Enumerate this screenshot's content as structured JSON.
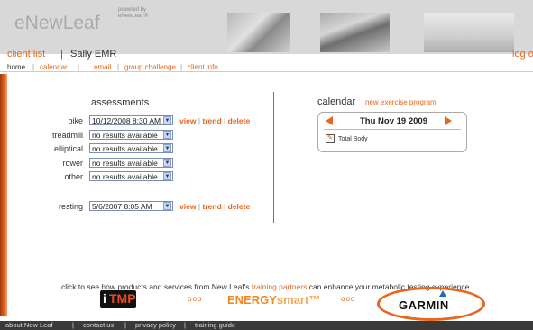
{
  "header": {
    "logo": "eNewLeaf",
    "powered_by": "powered by",
    "powered_by_brand": "eNewLeaf ®",
    "images": [
      "cyclists-photo",
      "spin-class-photo",
      "runner-photo"
    ],
    "client_list_label": "client list",
    "client_separator": "|",
    "client_name": "Sally EMR",
    "logout_label": "log out"
  },
  "nav": {
    "items": [
      "home",
      "calendar",
      "email",
      "group challenge",
      "client info"
    ],
    "separator": "|"
  },
  "assessments": {
    "title": "assessments",
    "rows": [
      {
        "label": "bike",
        "value": "10/12/2008 8:30 AM",
        "actions": [
          "view",
          "trend",
          "delete"
        ]
      },
      {
        "label": "treadmill",
        "value": "no results available",
        "actions": []
      },
      {
        "label": "elliptical",
        "value": "no results available",
        "actions": []
      },
      {
        "label": "rower",
        "value": "no results available",
        "actions": []
      },
      {
        "label": "other",
        "value": "no results available",
        "actions": []
      }
    ],
    "resting": {
      "label": "resting",
      "value": "5/6/2007 8:05 AM",
      "actions": [
        "view",
        "trend",
        "delete"
      ]
    },
    "action_separator": "|",
    "dropdown_arrow": "▼"
  },
  "calendar": {
    "title": "calendar",
    "new_program_label": "new exercise program",
    "date": "Thu Nov 19 2009",
    "events": [
      {
        "icon": "exercise-icon",
        "label": "Total Body"
      }
    ]
  },
  "promo": {
    "text_before": "click to see how products and services from New Leaf's",
    "link": "training partners",
    "text_after": "can enhance your metabolic testing experience",
    "dots": "ooo",
    "partners": {
      "itmp_i": "i",
      "itmp_tmp": "TMP",
      "energy": "ENERGY",
      "smart": "smart™",
      "garmin": "GARMIN"
    }
  },
  "footer": {
    "items": [
      "about New Leaf",
      "contact us",
      "privacy policy",
      "training guide"
    ],
    "separator": "|"
  },
  "colors": {
    "accent": "#e8661e",
    "header_bg": "#d8d8d8",
    "footer_bg": "#3a3a3a",
    "select_border": "#7a8fb4"
  }
}
